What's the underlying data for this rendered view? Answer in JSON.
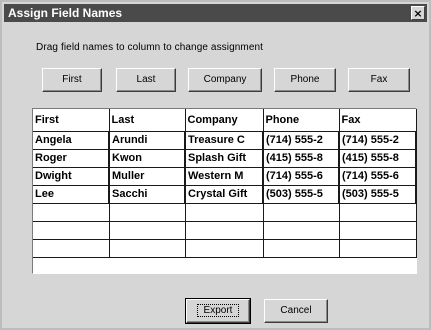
{
  "window": {
    "title": "Assign Field Names",
    "close_glyph": "×"
  },
  "instruction": "Drag field names to column to change assignment",
  "field_buttons": [
    {
      "label": "First"
    },
    {
      "label": "Last"
    },
    {
      "label": "Company"
    },
    {
      "label": "Phone"
    },
    {
      "label": "Fax"
    }
  ],
  "table": {
    "headers": [
      "First",
      "Last",
      "Company",
      "Phone",
      "Fax"
    ],
    "rows": [
      [
        "Angela",
        "Arundi",
        "Treasure C",
        "(714) 555-2",
        "(714) 555-2"
      ],
      [
        "Roger",
        "Kwon",
        "Splash Gift",
        "(415) 555-8",
        "(415) 555-8"
      ],
      [
        "Dwight",
        "Muller",
        "Western M",
        "(714) 555-6",
        "(714) 555-6"
      ],
      [
        "Lee",
        "Sacchi",
        "Crystal Gift",
        "(503) 555-5",
        "(503) 555-5"
      ],
      [
        "",
        "",
        "",
        "",
        ""
      ],
      [
        "",
        "",
        "",
        "",
        ""
      ],
      [
        "",
        "",
        "",
        "",
        ""
      ]
    ]
  },
  "buttons": {
    "export_label": "Export",
    "cancel_label": "Cancel"
  }
}
